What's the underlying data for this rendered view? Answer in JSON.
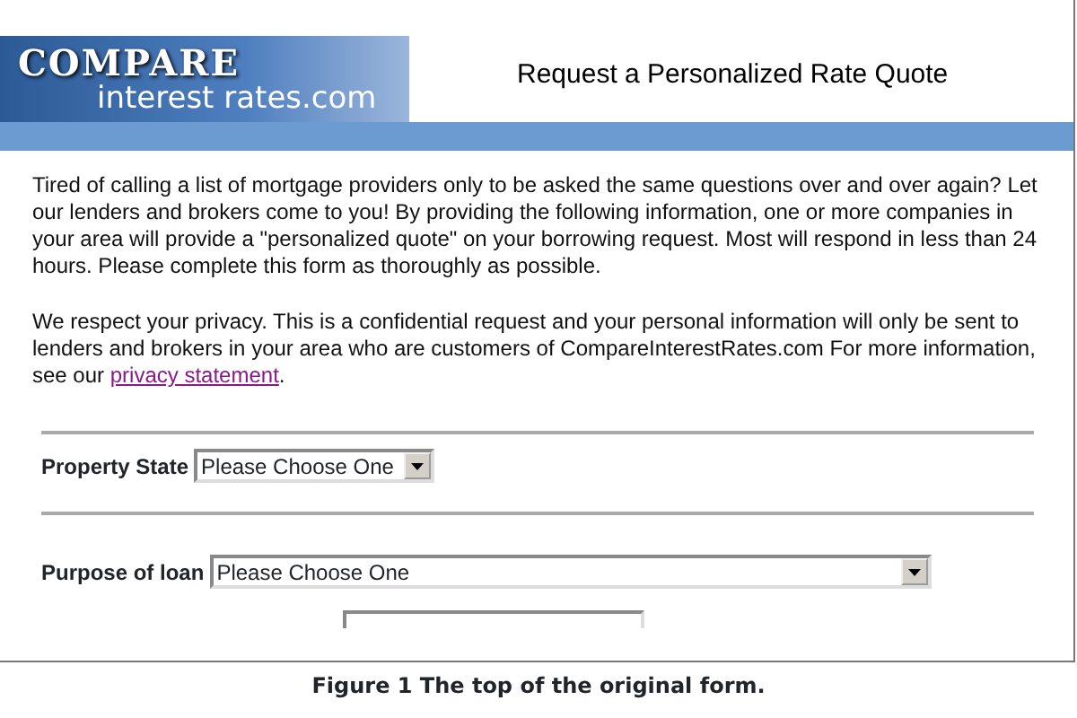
{
  "logo": {
    "word": "COMPARE",
    "domain": "interest rates.com"
  },
  "page_title": "Request a Personalized Rate Quote",
  "intro": "Tired of calling a list of mortgage providers only to be asked the same questions over and over again? Let our lenders and brokers come to you! By providing the following information, one or more companies in your area will provide a \"personalized quote\" on your borrowing request. Most will respond in less than 24 hours. Please complete this form as thoroughly as possible.",
  "privacy": {
    "text": "We respect your privacy. This is a confidential request and your personal information will only be sent to lenders and brokers in your area who are customers of CompareInterestRates.com For more information, see our ",
    "link": "privacy statement",
    "after": "."
  },
  "fields": [
    {
      "label": "Property State",
      "value": "Please Choose One",
      "kind": "short"
    },
    {
      "label": "Purpose of loan",
      "value": "Please Choose One",
      "kind": "wide"
    }
  ],
  "caption": "Figure 1 The top of the original form."
}
